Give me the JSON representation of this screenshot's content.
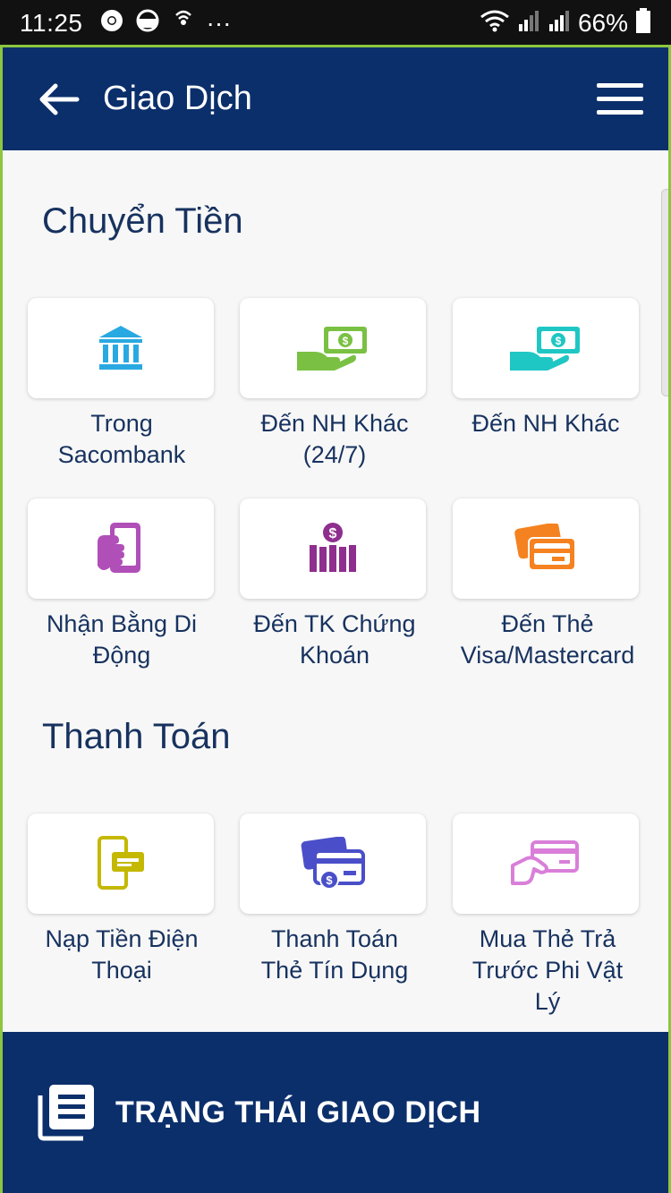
{
  "statusbar": {
    "time": "11:25",
    "more": "···",
    "battery": "66%"
  },
  "header": {
    "title": "Giao Dịch"
  },
  "sections": [
    {
      "title": "Chuyển Tiền",
      "items": [
        {
          "label_line1": "Trong",
          "label_line2": "Sacombank",
          "icon": "bank-icon",
          "color": "#29a9e1"
        },
        {
          "label_line1": "Đến NH Khác",
          "label_line2": "(24/7)",
          "icon": "cash-hand-icon",
          "color": "#7ac143"
        },
        {
          "label_line1": "Đến NH Khác",
          "label_line2": "",
          "icon": "cash-hand-icon",
          "color": "#1fc7c4"
        },
        {
          "label_line1": "Nhận Bằng Di",
          "label_line2": "Động",
          "icon": "phone-hand-icon",
          "color": "#b04fb8"
        },
        {
          "label_line1": "Đến TK Chứng",
          "label_line2": "Khoán",
          "icon": "stock-chart-icon",
          "color": "#8e2e8e"
        },
        {
          "label_line1": "Đến Thẻ",
          "label_line2": "Visa/Mastercard",
          "icon": "cards-icon",
          "color": "#f58220"
        }
      ]
    },
    {
      "title": "Thanh Toán",
      "items": [
        {
          "label_line1": "Nạp Tiền Điện",
          "label_line2": "Thoại",
          "label_line3": "",
          "icon": "phone-topup-icon",
          "color": "#c4b800"
        },
        {
          "label_line1": "Thanh Toán",
          "label_line2": "Thẻ Tín Dụng",
          "label_line3": "",
          "icon": "credit-card-pay-icon",
          "color": "#4a4fc9"
        },
        {
          "label_line1": "Mua Thẻ Trả",
          "label_line2": "Trước Phi Vật",
          "label_line3": "Lý",
          "icon": "prepaid-card-icon",
          "color": "#d97fd9"
        }
      ]
    }
  ],
  "footer": {
    "label": "TRẠNG THÁI GIAO DỊCH"
  },
  "colors": {
    "header_bg": "#0b2f6b",
    "text_primary": "#17325f",
    "accent_border": "#8dc63f"
  }
}
